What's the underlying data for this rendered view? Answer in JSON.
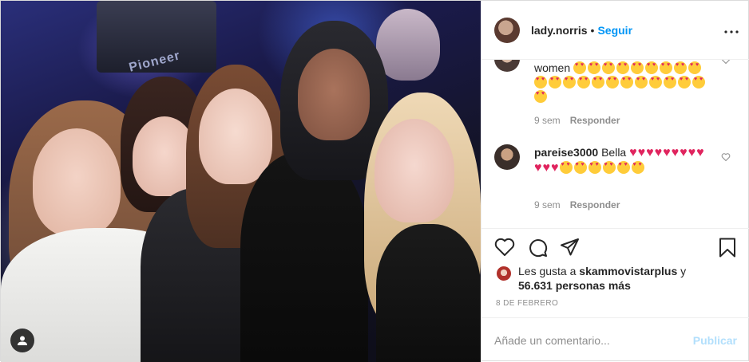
{
  "header": {
    "username": "lady.norris",
    "separator": "•",
    "follow_label": "Seguir",
    "more_icon": "more-horizontal-icon"
  },
  "photo": {
    "background_text": "Pioneer",
    "tag_icon": "user-tag-icon"
  },
  "comments": [
    {
      "username": "",
      "text": "women",
      "emojis": [
        "😍",
        "😍",
        "😍",
        "😍",
        "😍",
        "😍",
        "😍",
        "😍",
        "😍",
        "😍",
        "😍",
        "😍",
        "😍",
        "😍",
        "😍",
        "😍",
        "😍",
        "😍",
        "😍",
        "😍",
        "😍",
        "😍"
      ],
      "time": "9 sem",
      "reply_label": "Responder"
    },
    {
      "username": "pareise3000",
      "text": "Bella",
      "emojis": [
        "❤️",
        "❤️",
        "❤️",
        "❤️",
        "❤️",
        "❤️",
        "❤️",
        "❤️",
        "❤️",
        "❤️",
        "❤️",
        "❤️",
        "😍",
        "😍",
        "😍",
        "😍",
        "😍",
        "😍"
      ],
      "time": "9 sem",
      "reply_label": "Responder"
    }
  ],
  "actions": {
    "like_icon": "heart-icon",
    "comment_icon": "comment-icon",
    "share_icon": "paper-plane-icon",
    "save_icon": "bookmark-icon"
  },
  "likes": {
    "prefix": "Les gusta a",
    "user": "skammovistarplus",
    "conjunction": "y",
    "count": "56.631 personas más"
  },
  "date": "8 DE FEBRERO",
  "add_comment": {
    "placeholder": "Añade un comentario...",
    "publish_label": "Publicar"
  },
  "colors": {
    "link_blue": "#0095f6",
    "publish_disabled": "#b2dffc",
    "muted_text": "#8e8e8e",
    "border": "#dbdbdb"
  }
}
